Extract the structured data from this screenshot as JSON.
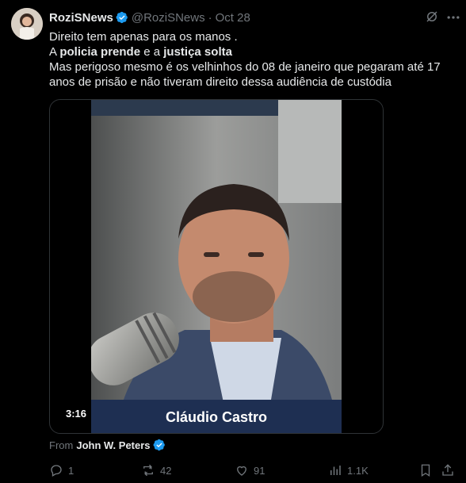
{
  "tweet": {
    "author_name": "RoziSNews",
    "handle": "@RoziSNews",
    "separator": "·",
    "date": "Oct 28",
    "line1": "Direito tem apenas para os manos .",
    "line2_a": "A ",
    "line2_b": "policia prende",
    "line2_c": " e a ",
    "line2_d": "justiça solta",
    "line3": "Mas perigoso mesmo é os velhinhos do 08 de janeiro que pegaram até 17 anos de prisão e não tiveram direito dessa audiência de custódia"
  },
  "media": {
    "duration": "3:16",
    "caption": "Cláudio Castro"
  },
  "from": {
    "label": "From",
    "author": "John W. Peters"
  },
  "actions": {
    "replies": "1",
    "reposts": "42",
    "likes": "91",
    "views": "1.1K"
  },
  "icons": {
    "verified": "verified-badge-icon",
    "grok": "grok-icon",
    "more": "more-icon"
  },
  "colors": {
    "verified": "#1d9bf0",
    "muted": "#71767b",
    "text": "#e7e9ea"
  }
}
